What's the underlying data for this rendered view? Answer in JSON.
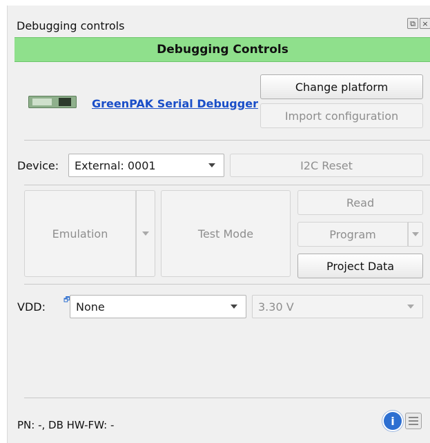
{
  "panel": {
    "title": "Debugging controls",
    "header": "Debugging Controls"
  },
  "platform": {
    "link_text": "GreenPAK Serial Debugger",
    "change_button": "Change platform",
    "import_button": "Import configuration"
  },
  "device": {
    "label": "Device:",
    "selected": "External: 0001",
    "i2c_reset": "I2C Reset"
  },
  "modes": {
    "emulation": "Emulation",
    "test_mode": "Test Mode",
    "read": "Read",
    "program": "Program",
    "project_data": "Project Data"
  },
  "vdd": {
    "label": "VDD:",
    "selected": "None",
    "voltage": "3.30 V"
  },
  "status": {
    "text": "PN: -, DB HW-FW: -"
  },
  "icons": {
    "info": "i"
  }
}
